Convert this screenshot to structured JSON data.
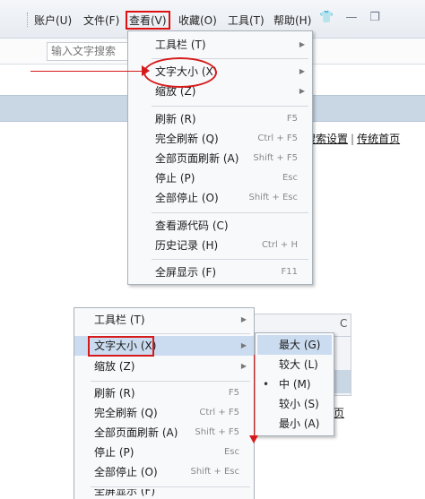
{
  "menubar": {
    "items": [
      {
        "label": "账户(U)"
      },
      {
        "label": "文件(F)"
      },
      {
        "label": "查看(V)"
      },
      {
        "label": "收藏(O)"
      },
      {
        "label": "工具(T)"
      },
      {
        "label": "帮助(H)"
      }
    ]
  },
  "search": {
    "placeholder": "输入文字搜索"
  },
  "links": {
    "search_settings": "搜索设置",
    "separator": "|",
    "classic_home": "传统首页"
  },
  "view_menu": {
    "toolbar": {
      "label": "工具栏 (T)"
    },
    "text_size": {
      "label": "文字大小 (X)"
    },
    "zoom": {
      "label": "缩放 (Z)"
    },
    "refresh": {
      "label": "刷新 (R)",
      "shortcut": "F5"
    },
    "full_refresh": {
      "label": "完全刷新 (Q)",
      "shortcut": "Ctrl + F5"
    },
    "refresh_all": {
      "label": "全部页面刷新 (A)",
      "shortcut": "Shift + F5"
    },
    "stop": {
      "label": "停止 (P)",
      "shortcut": "Esc"
    },
    "stop_all": {
      "label": "全部停止 (O)",
      "shortcut": "Shift + Esc"
    },
    "view_source": {
      "label": "查看源代码 (C)"
    },
    "history": {
      "label": "历史记录 (H)",
      "shortcut": "Ctrl + H"
    },
    "fullscreen": {
      "label": "全屏显示 (F)",
      "shortcut": "F11"
    }
  },
  "text_size_submenu": {
    "largest": "最大 (G)",
    "larger": "较大 (L)",
    "medium": "中 (M)",
    "smaller": "较小 (S)",
    "smallest": "最小 (A)",
    "selected_bullet": "•"
  },
  "bottom_fragment": {
    "page_char": "页",
    "partial_char": "C"
  },
  "colors": {
    "highlight": "#cbdcf0",
    "annotation_red": "#d61a1a"
  }
}
